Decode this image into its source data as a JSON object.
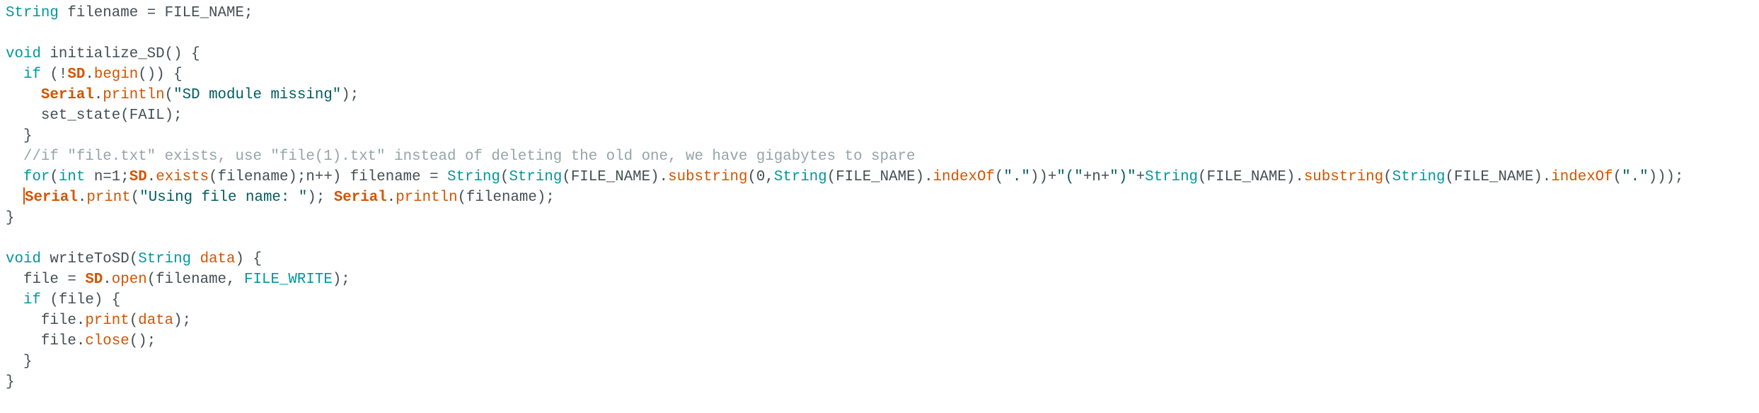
{
  "editor": {
    "lines": [
      [
        {
          "c": "kw",
          "t": "String"
        },
        {
          "c": "tx",
          "t": " filename = FILE_NAME;"
        }
      ],
      [],
      [
        {
          "c": "kw",
          "t": "void"
        },
        {
          "c": "tx",
          "t": " initialize_SD() {"
        }
      ],
      [
        {
          "c": "tx",
          "t": "  "
        },
        {
          "c": "kw",
          "t": "if"
        },
        {
          "c": "tx",
          "t": " (!"
        },
        {
          "c": "obj",
          "t": "SD"
        },
        {
          "c": "tx",
          "t": "."
        },
        {
          "c": "fn",
          "t": "begin"
        },
        {
          "c": "tx",
          "t": "()) {"
        }
      ],
      [
        {
          "c": "tx",
          "t": "    "
        },
        {
          "c": "obj",
          "t": "Serial"
        },
        {
          "c": "tx",
          "t": "."
        },
        {
          "c": "fn",
          "t": "println"
        },
        {
          "c": "tx",
          "t": "("
        },
        {
          "c": "st",
          "t": "\"SD module missing\""
        },
        {
          "c": "tx",
          "t": ");"
        }
      ],
      [
        {
          "c": "tx",
          "t": "    set_state(FAIL);"
        }
      ],
      [
        {
          "c": "tx",
          "t": "  }"
        }
      ],
      [
        {
          "c": "cm",
          "t": "  //if \"file.txt\" exists, use \"file(1).txt\" instead of deleting the old one, we have gigabytes to spare"
        }
      ],
      [
        {
          "c": "tx",
          "t": "  "
        },
        {
          "c": "kw",
          "t": "for"
        },
        {
          "c": "tx",
          "t": "("
        },
        {
          "c": "kw",
          "t": "int"
        },
        {
          "c": "tx",
          "t": " n=1;"
        },
        {
          "c": "obj",
          "t": "SD"
        },
        {
          "c": "tx",
          "t": "."
        },
        {
          "c": "fn",
          "t": "exists"
        },
        {
          "c": "tx",
          "t": "(filename);n++) filename = "
        },
        {
          "c": "kw",
          "t": "String"
        },
        {
          "c": "tx",
          "t": "("
        },
        {
          "c": "kw",
          "t": "String"
        },
        {
          "c": "tx",
          "t": "(FILE_NAME)."
        },
        {
          "c": "fn",
          "t": "substring"
        },
        {
          "c": "tx",
          "t": "(0,"
        },
        {
          "c": "kw",
          "t": "String"
        },
        {
          "c": "tx",
          "t": "(FILE_NAME)."
        },
        {
          "c": "fn",
          "t": "indexOf"
        },
        {
          "c": "tx",
          "t": "("
        },
        {
          "c": "st",
          "t": "\".\""
        },
        {
          "c": "tx",
          "t": "))+"
        },
        {
          "c": "st",
          "t": "\"(\""
        },
        {
          "c": "tx",
          "t": "+n+"
        },
        {
          "c": "st",
          "t": "\")\""
        },
        {
          "c": "tx",
          "t": "+"
        },
        {
          "c": "kw",
          "t": "String"
        },
        {
          "c": "tx",
          "t": "(FILE_NAME)."
        },
        {
          "c": "fn",
          "t": "substring"
        },
        {
          "c": "tx",
          "t": "("
        },
        {
          "c": "kw",
          "t": "String"
        },
        {
          "c": "tx",
          "t": "(FILE_NAME)."
        },
        {
          "c": "fn",
          "t": "indexOf"
        },
        {
          "c": "tx",
          "t": "("
        },
        {
          "c": "st",
          "t": "\".\""
        },
        {
          "c": "tx",
          "t": ")));"
        }
      ],
      [
        {
          "c": "tx",
          "t": "  "
        },
        {
          "c": "caret",
          "t": ""
        },
        {
          "c": "obj",
          "t": "Serial"
        },
        {
          "c": "tx",
          "t": "."
        },
        {
          "c": "fn",
          "t": "print"
        },
        {
          "c": "tx",
          "t": "("
        },
        {
          "c": "st",
          "t": "\"Using file name: \""
        },
        {
          "c": "tx",
          "t": "); "
        },
        {
          "c": "obj",
          "t": "Serial"
        },
        {
          "c": "tx",
          "t": "."
        },
        {
          "c": "fn",
          "t": "println"
        },
        {
          "c": "tx",
          "t": "(filename);"
        }
      ],
      [
        {
          "c": "tx",
          "t": "}"
        }
      ],
      [],
      [
        {
          "c": "kw",
          "t": "void"
        },
        {
          "c": "tx",
          "t": " writeToSD("
        },
        {
          "c": "kw",
          "t": "String"
        },
        {
          "c": "tx",
          "t": " "
        },
        {
          "c": "fn",
          "t": "data"
        },
        {
          "c": "tx",
          "t": ") {"
        }
      ],
      [
        {
          "c": "tx",
          "t": "  file = "
        },
        {
          "c": "obj",
          "t": "SD"
        },
        {
          "c": "tx",
          "t": "."
        },
        {
          "c": "fn",
          "t": "open"
        },
        {
          "c": "tx",
          "t": "(filename, "
        },
        {
          "c": "kw",
          "t": "FILE_WRITE"
        },
        {
          "c": "tx",
          "t": ");"
        }
      ],
      [
        {
          "c": "tx",
          "t": "  "
        },
        {
          "c": "kw",
          "t": "if"
        },
        {
          "c": "tx",
          "t": " (file) {"
        }
      ],
      [
        {
          "c": "tx",
          "t": "    file."
        },
        {
          "c": "fn",
          "t": "print"
        },
        {
          "c": "tx",
          "t": "("
        },
        {
          "c": "fn",
          "t": "data"
        },
        {
          "c": "tx",
          "t": ");"
        }
      ],
      [
        {
          "c": "tx",
          "t": "    file."
        },
        {
          "c": "fn",
          "t": "close"
        },
        {
          "c": "tx",
          "t": "();"
        }
      ],
      [
        {
          "c": "tx",
          "t": "  }"
        }
      ],
      [
        {
          "c": "tx",
          "t": "}"
        }
      ]
    ]
  }
}
